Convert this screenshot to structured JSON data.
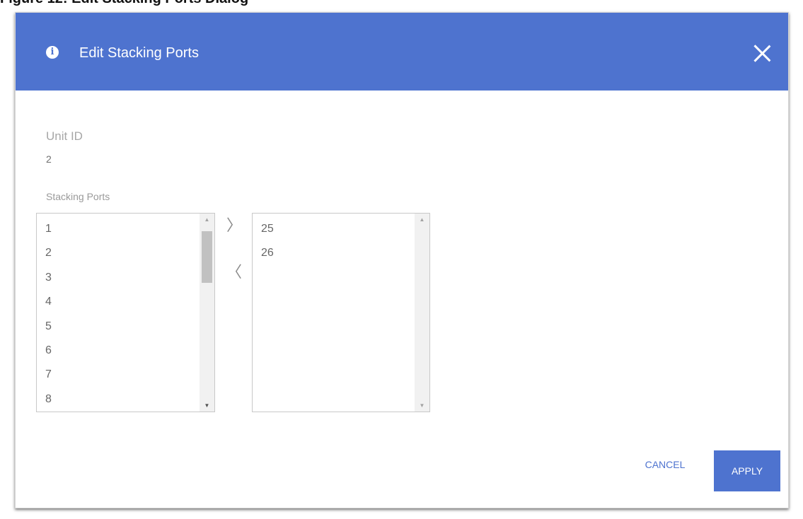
{
  "page_caption": "Figure 12: Edit Stacking Ports Dialog",
  "dialog": {
    "title": "Edit Stacking Ports",
    "info_glyph": "i",
    "unit_id_label": "Unit ID",
    "unit_id_value": "2",
    "stacking_ports_label": "Stacking Ports",
    "available_ports": [
      "1",
      "2",
      "3",
      "4",
      "5",
      "6",
      "7",
      "8"
    ],
    "selected_ports": [
      "25",
      "26"
    ],
    "move_right_glyph": "〉",
    "move_left_glyph": "〈",
    "cancel_label": "CANCEL",
    "apply_label": "APPLY"
  },
  "icons": {
    "info": "info-icon",
    "close": "close-icon",
    "move_right": "chevron-right-icon",
    "move_left": "chevron-left-icon",
    "scroll_up": "scroll-up-arrow",
    "scroll_down": "scroll-down-arrow"
  },
  "colors": {
    "header_bg": "#4e73cf",
    "primary_button": "#4e73cf",
    "label_text": "#a7a7a7",
    "list_text": "#666666"
  }
}
